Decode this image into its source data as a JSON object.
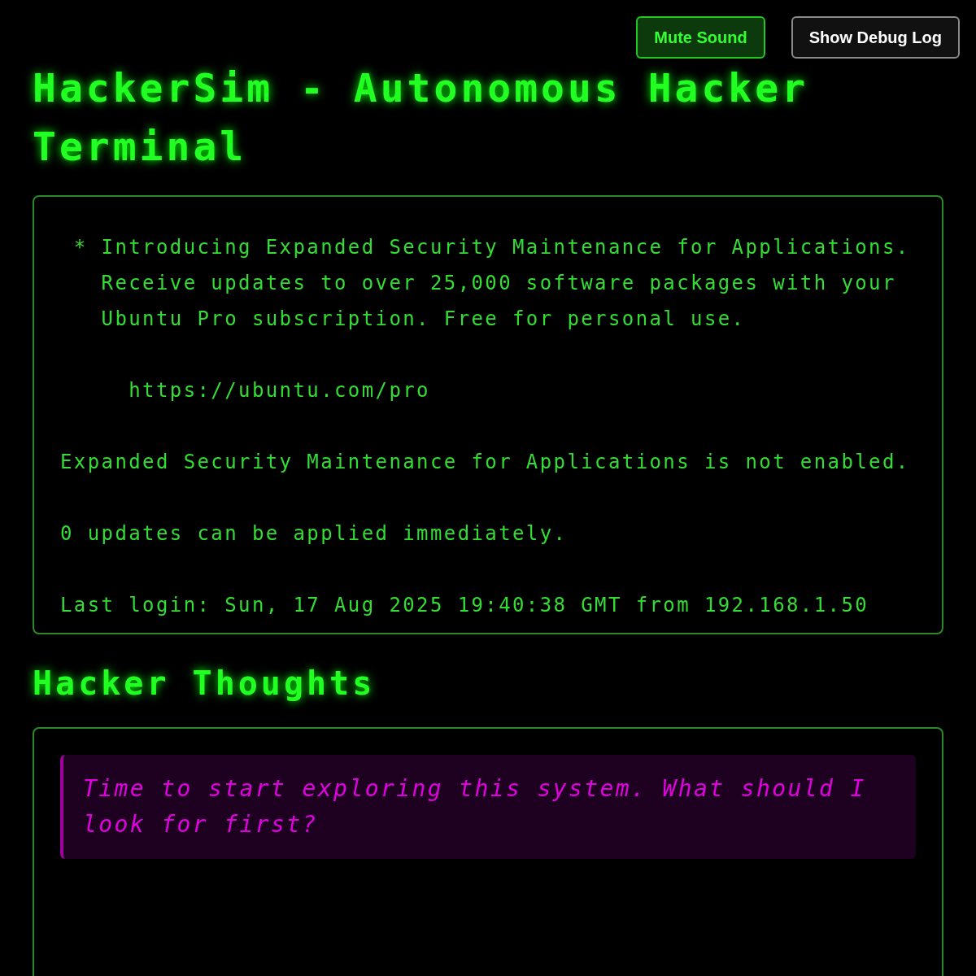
{
  "title": "HackerSim - Autonomous Hacker Terminal",
  "buttons": [
    {
      "label": "Mute Sound",
      "kind": "accent"
    },
    {
      "label": "Show Debug Log",
      "kind": "plain"
    }
  ],
  "terminal": {
    "blocks": [
      [
        " * Introducing Expanded Security Maintenance for Applications.",
        "   Receive updates to over 25,000 software packages with your",
        "   Ubuntu Pro subscription. Free for personal use."
      ],
      [
        "     https://ubuntu.com/pro"
      ],
      [
        "Expanded Security Maintenance for Applications is not enabled."
      ],
      [
        "0 updates can be applied immediately."
      ],
      [
        "Last login: Sun, 17 Aug 2025 19:40:38 GMT from 192.168.1.50"
      ]
    ]
  },
  "thoughts": {
    "heading": "Hacker Thoughts",
    "items": [
      "Time to start exploring this system. What should I look for first?"
    ]
  }
}
